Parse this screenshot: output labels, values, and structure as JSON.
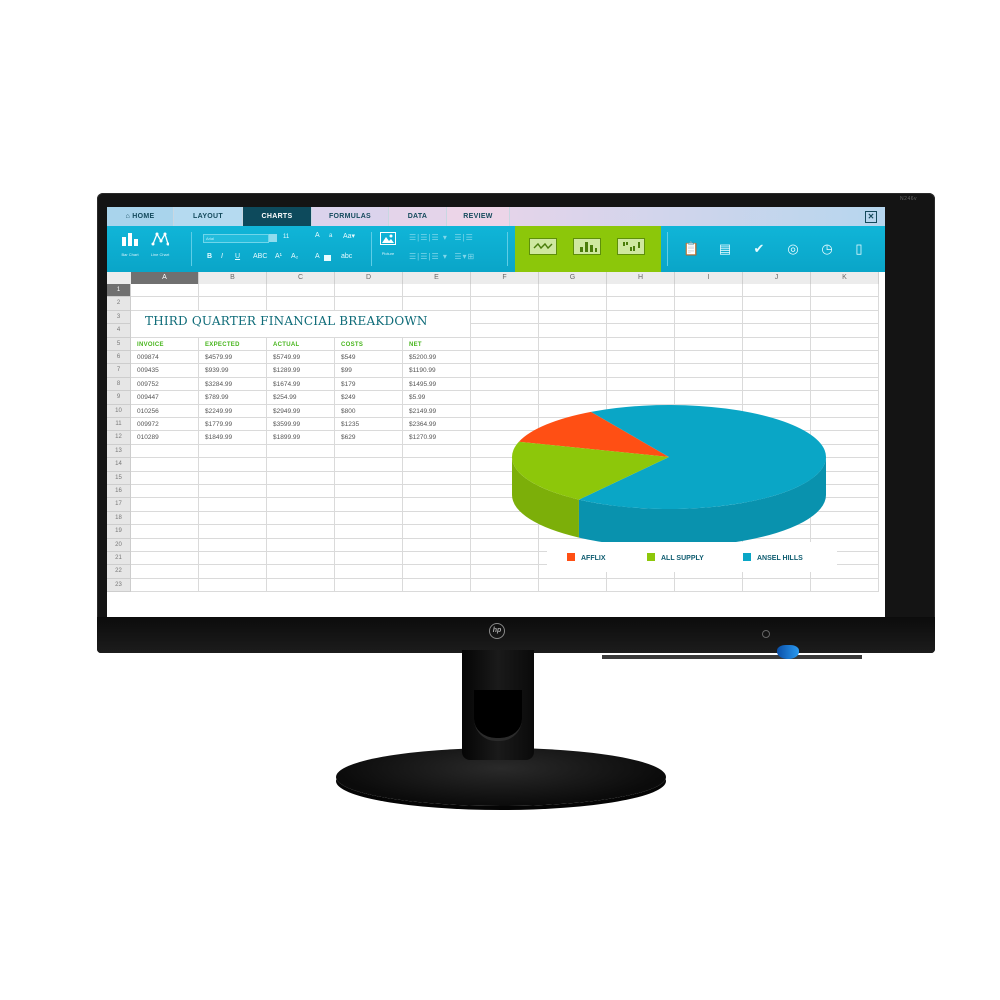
{
  "device": {
    "brand_logo": "hp",
    "model_label": "N246v"
  },
  "tabs": [
    {
      "label": "⌂ HOME",
      "icon": "home-icon"
    },
    {
      "label": "LAYOUT"
    },
    {
      "label": "CHARTS",
      "active": true
    },
    {
      "label": "FORMULAS"
    },
    {
      "label": "DATA"
    },
    {
      "label": "REVIEW"
    }
  ],
  "window": {
    "close_glyph": "✕"
  },
  "ribbon": {
    "bar_chart_label": "Bar Chart",
    "line_chart_label": "Line Chart",
    "font_name": "Arial",
    "font_size": "11",
    "grow_font": "A",
    "shrink_font": "a",
    "change_case": "Aa▾",
    "bold": "B",
    "italic": "I",
    "underline": "U",
    "strikethrough": "ABC",
    "superscript": "A¹",
    "subscript": "A₂",
    "highlight": "A",
    "clear_format": "abc",
    "picture_label": "Picture",
    "chart_types": [
      "line-chart-icon",
      "bar-chart-icon",
      "column-chart-icon"
    ],
    "right_icons": [
      "checklist-icon",
      "clipboard-icon",
      "checkmark-icon",
      "target-icon",
      "clock-icon",
      "book-icon"
    ]
  },
  "sheet": {
    "columns": [
      "A",
      "B",
      "C",
      "D",
      "E",
      "F",
      "G",
      "H",
      "I",
      "J",
      "K"
    ],
    "rows": [
      "1",
      "2",
      "3",
      "4",
      "5",
      "6",
      "7",
      "8",
      "9",
      "10",
      "11",
      "12",
      "13",
      "14",
      "15",
      "16",
      "17",
      "18",
      "19",
      "20",
      "21",
      "22",
      "23"
    ],
    "selected_cell": "A1",
    "title": "THIRD QUARTER FINANCIAL BREAKDOWN",
    "headers": [
      "INVOICE",
      "EXPECTED",
      "ACTUAL",
      "COSTS",
      "NET"
    ],
    "data": [
      [
        "009874",
        "$4579.99",
        "$5749.99",
        "$549",
        "$5200.99"
      ],
      [
        "009435",
        "$939.99",
        "$1289.99",
        "$99",
        "$1190.99"
      ],
      [
        "009752",
        "$3284.99",
        "$1674.99",
        "$179",
        "$1495.99"
      ],
      [
        "009447",
        "$789.99",
        "$254.99",
        "$249",
        "$5.99"
      ],
      [
        "010256",
        "$2249.99",
        "$2949.99",
        "$800",
        "$2149.99"
      ],
      [
        "009972",
        "$1779.99",
        "$3599.99",
        "$1235",
        "$2364.99"
      ],
      [
        "010289",
        "$1849.99",
        "$1899.99",
        "$629",
        "$1270.99"
      ]
    ]
  },
  "chart_data": {
    "type": "pie",
    "style": "3d",
    "title": "",
    "categories": [
      "AFFLIX",
      "ALL SUPPLY",
      "ANSEL HILLS"
    ],
    "values": [
      12,
      20,
      68
    ],
    "colors": [
      "#ff4f14",
      "#8dc70a",
      "#0aa6c6"
    ],
    "legend": "bottom"
  }
}
